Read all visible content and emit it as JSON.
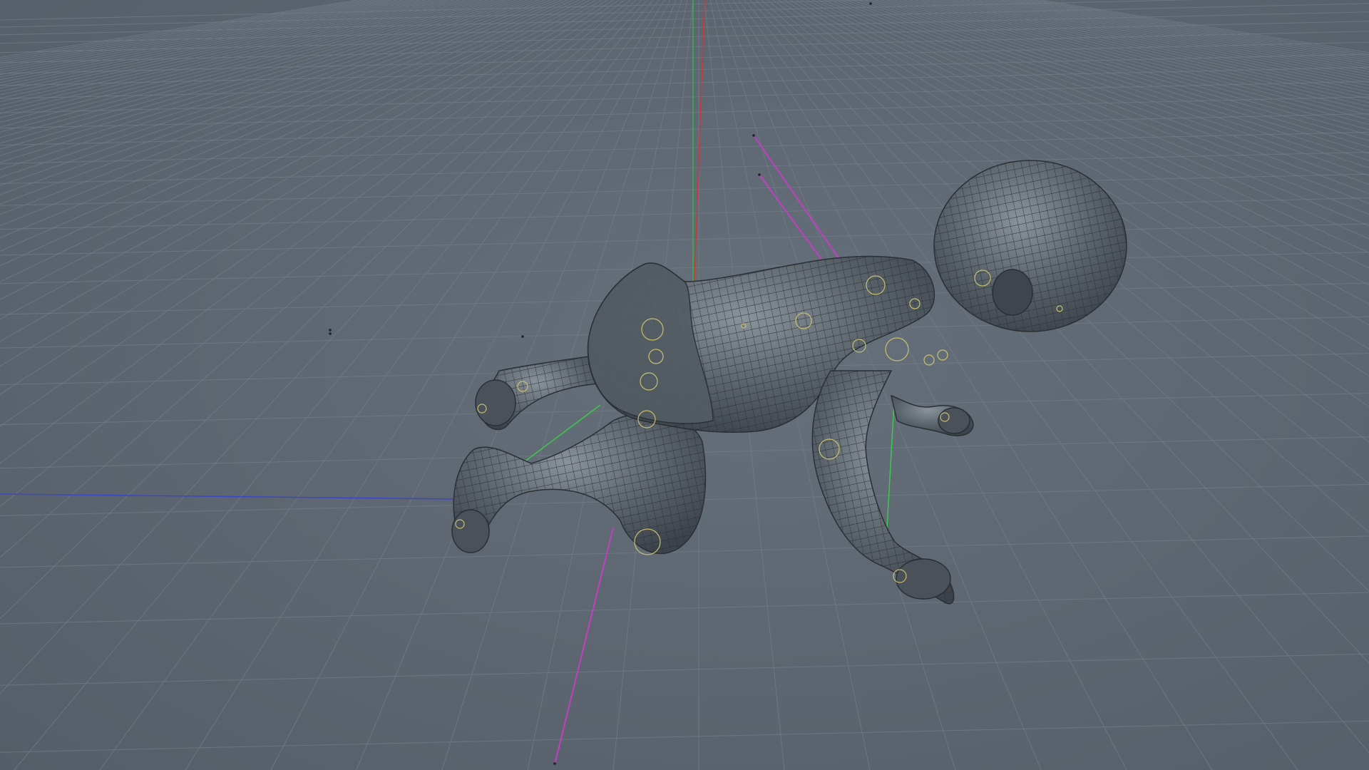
{
  "viewport": {
    "background": "#5d6670",
    "grid_color": "#737d87",
    "axis_colors": {
      "x_axis": "#c83a3a",
      "y_axis": "#3ab04a",
      "z_axis": "#3a48c8"
    },
    "mesh": {
      "fill": "#4b535b",
      "wire": "#2a2f35",
      "highlight": "#8a929a"
    },
    "rig": {
      "bone_lines_green": "#3cc84a",
      "bone_lines_magenta": "#c040c0",
      "joint_circles": "#c8c070"
    },
    "object_icon": "crawling-baby-mesh-icon"
  }
}
